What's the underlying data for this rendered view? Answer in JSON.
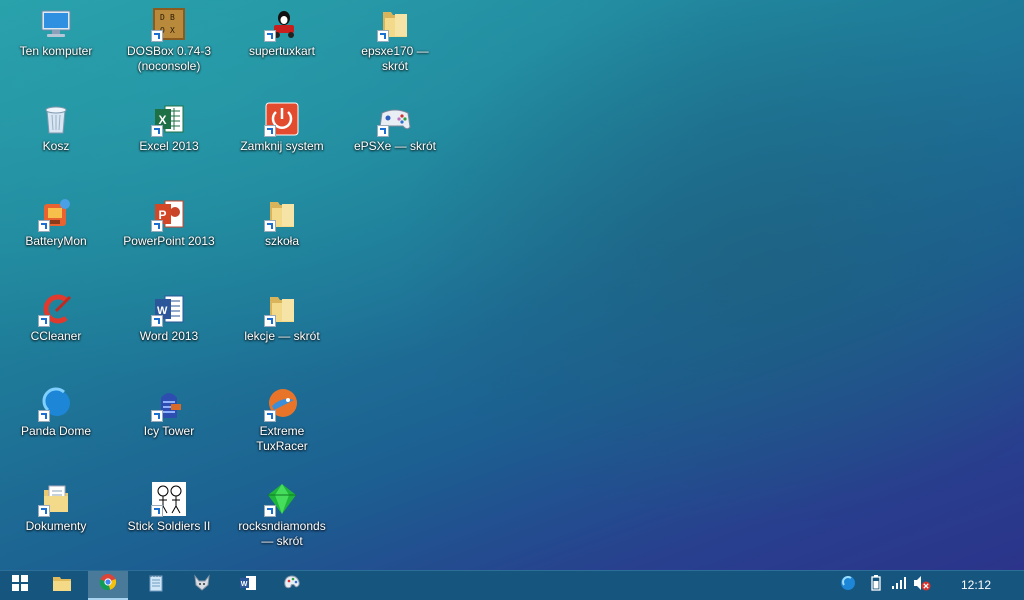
{
  "desktop": {
    "icons": [
      {
        "label": "Ten komputer",
        "icon": "computer-icon"
      },
      {
        "label": "DOSBox 0.74-3 (noconsole)",
        "icon": "dosbox-icon"
      },
      {
        "label": "supertuxkart",
        "icon": "supertuxkart-icon"
      },
      {
        "label": "epsxe170 — skrót",
        "icon": "folder-icon"
      },
      {
        "label": "Kosz",
        "icon": "recycle-bin-icon"
      },
      {
        "label": "Excel 2013",
        "icon": "excel-icon"
      },
      {
        "label": "Zamknij system",
        "icon": "power-icon"
      },
      {
        "label": "ePSXe — skrót",
        "icon": "gamepad-icon"
      },
      {
        "label": "BatteryMon",
        "icon": "batterymon-icon"
      },
      {
        "label": "PowerPoint 2013",
        "icon": "powerpoint-icon"
      },
      {
        "label": "szkoła",
        "icon": "folder-icon"
      },
      {
        "label": "CCleaner",
        "icon": "ccleaner-icon"
      },
      {
        "label": "Word 2013",
        "icon": "word-icon"
      },
      {
        "label": "lekcje — skrót",
        "icon": "folder-icon"
      },
      {
        "label": "Panda Dome",
        "icon": "panda-dome-icon"
      },
      {
        "label": "Icy Tower",
        "icon": "icy-tower-icon"
      },
      {
        "label": "Extreme TuxRacer",
        "icon": "tuxracer-icon"
      },
      {
        "label": "Dokumenty",
        "icon": "documents-icon"
      },
      {
        "label": "Stick Soldiers II",
        "icon": "stick-soldiers-icon"
      },
      {
        "label": "rocksndiamonds — skrót",
        "icon": "rocksndiamonds-icon"
      }
    ]
  },
  "taskbar": {
    "buttons": [
      {
        "icon": "windows-start-icon"
      },
      {
        "icon": "file-explorer-icon"
      },
      {
        "icon": "chrome-icon",
        "active": true
      },
      {
        "icon": "notepad-icon"
      },
      {
        "icon": "fox-app-icon"
      },
      {
        "icon": "word-icon"
      },
      {
        "icon": "paint-icon"
      }
    ],
    "tray": {
      "icons": [
        "panda-tray-icon",
        "battery-icon",
        "signal-icon",
        "volume-muted-icon"
      ],
      "clock": "12:12"
    }
  },
  "colors": {
    "taskbar": "#16557e",
    "desktop_top": "#2aa3ad",
    "desktop_bottom": "#2b348a"
  }
}
